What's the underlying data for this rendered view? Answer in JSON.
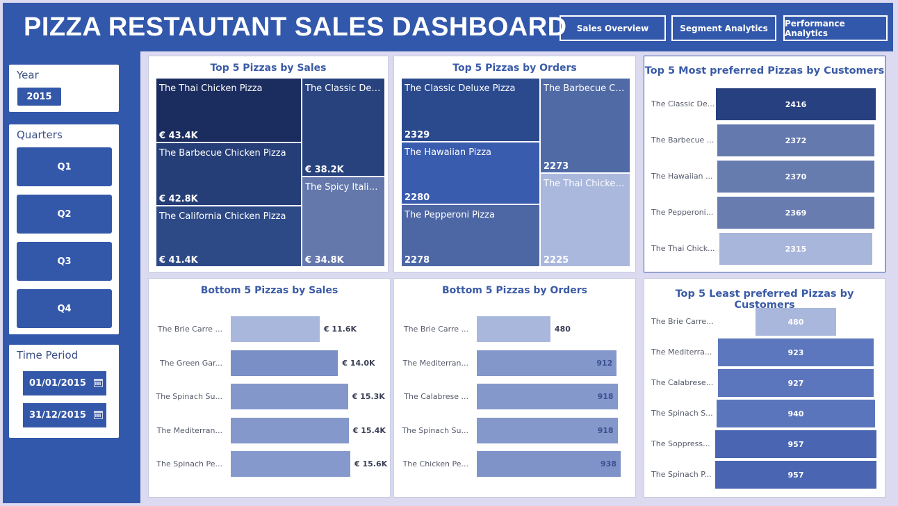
{
  "header": {
    "title": "PIZZA RESTAUTANT SALES DASHBOARD",
    "nav": [
      "Sales Overview",
      "Segment Analytics",
      "Performance Analytics"
    ]
  },
  "filters": {
    "year_label": "Year",
    "year_value": "2015",
    "quarters_label": "Quarters",
    "quarters": [
      "Q1",
      "Q2",
      "Q3",
      "Q4"
    ],
    "time_period_label": "Time Period",
    "start_date": "01/01/2015",
    "end_date": "31/12/2015"
  },
  "top_sales": {
    "title": "Top 5 Pizzas by Sales",
    "items": [
      {
        "name": "The Thai Chicken Pizza",
        "value": "€ 43.4K",
        "color": "#1b2c5f"
      },
      {
        "name": "The Barbecue Chicken Pizza",
        "value": "€ 42.8K",
        "color": "#253e77"
      },
      {
        "name": "The California Chicken Pizza",
        "value": "€ 41.4K",
        "color": "#2e4a86"
      },
      {
        "name": "The Classic Del...",
        "value": "€ 38.2K",
        "color": "#28427d"
      },
      {
        "name": "The Spicy Italia...",
        "value": "€ 34.8K",
        "color": "#6478ac"
      }
    ]
  },
  "top_orders": {
    "title": "Top 5 Pizzas by Orders",
    "items": [
      {
        "name": "The Classic Deluxe Pizza",
        "value": "2329",
        "color": "#2b4a8e"
      },
      {
        "name": "The Hawaiian Pizza",
        "value": "2280",
        "color": "#3a5cae"
      },
      {
        "name": "The Pepperoni Pizza",
        "value": "2278",
        "color": "#4d66a4"
      },
      {
        "name": "The Barbecue Ch...",
        "value": "2273",
        "color": "#506aa6"
      },
      {
        "name": "The Thai Chicken...",
        "value": "2225",
        "color": "#aab8dd"
      }
    ]
  },
  "most_preferred": {
    "title": "Top 5 Most preferred Pizzas by Customers",
    "items": [
      {
        "name": "The Classic De...",
        "value": 2416,
        "color": "#27407f"
      },
      {
        "name": "The Barbecue ...",
        "value": 2372,
        "color": "#6479ad"
      },
      {
        "name": "The Hawaiian ...",
        "value": 2370,
        "color": "#667bae"
      },
      {
        "name": "The Pepperoni...",
        "value": 2369,
        "color": "#687caf"
      },
      {
        "name": "The Thai Chick...",
        "value": 2315,
        "color": "#a9b6db"
      }
    ]
  },
  "bottom_sales": {
    "title": "Bottom 5 Pizzas by Sales",
    "items": [
      {
        "name": "The Brie Carre ...",
        "value": 11.6,
        "label": "€ 11.6K",
        "color": "#a9b7dc"
      },
      {
        "name": "The Green Gar...",
        "value": 14.0,
        "label": "€ 14.0K",
        "color": "#7a8fc6"
      },
      {
        "name": "The Spinach Su...",
        "value": 15.3,
        "label": "€ 15.3K",
        "color": "#8497cb"
      },
      {
        "name": "The Mediterran...",
        "value": 15.4,
        "label": "€ 15.4K",
        "color": "#8598cb"
      },
      {
        "name": "The Spinach Pe...",
        "value": 15.6,
        "label": "€ 15.6K",
        "color": "#8699cc"
      }
    ]
  },
  "bottom_orders": {
    "title": "Bottom 5 Pizzas by Orders",
    "items": [
      {
        "name": "The Brie Carre ...",
        "value": 480,
        "label": "480",
        "color": "#a9b7dc"
      },
      {
        "name": "The Mediterran...",
        "value": 912,
        "label": "912",
        "color": "#8497cb"
      },
      {
        "name": "The Calabrese ...",
        "value": 918,
        "label": "918",
        "color": "#8598cb"
      },
      {
        "name": "The Spinach Su...",
        "value": 918,
        "label": "918",
        "color": "#8598cb"
      },
      {
        "name": "The Chicken Pe...",
        "value": 938,
        "label": "938",
        "color": "#7f93c9"
      }
    ]
  },
  "least_preferred": {
    "title": "Top 5 Least preferred Pizzas by Customers",
    "items": [
      {
        "name": "The Brie Carre...",
        "value": 480,
        "color": "#a9b7dc"
      },
      {
        "name": "The Mediterra...",
        "value": 923,
        "color": "#5c77bd"
      },
      {
        "name": "The Calabrese...",
        "value": 927,
        "color": "#5b76bc"
      },
      {
        "name": "The Spinach S...",
        "value": 940,
        "color": "#5a75bc"
      },
      {
        "name": "The Soppress...",
        "value": 957,
        "color": "#4a66b2"
      },
      {
        "name": "The Spinach P...",
        "value": 957,
        "color": "#4a66b2"
      }
    ]
  }
}
